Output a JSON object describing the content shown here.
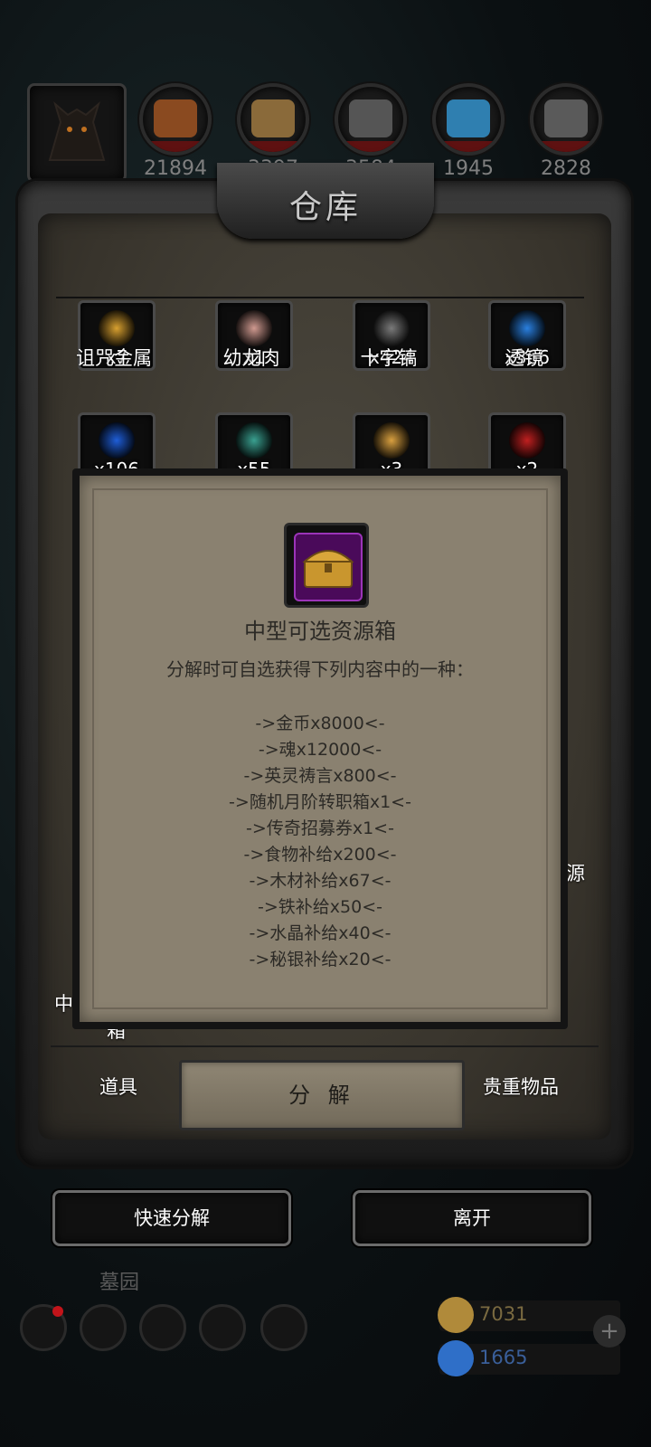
{
  "resources": [
    {
      "icon": "food-icon",
      "count": "21894",
      "color": "#8a4a20"
    },
    {
      "icon": "wood-icon",
      "count": "3397",
      "color": "#8a6a3a"
    },
    {
      "icon": "iron-icon",
      "count": "3584",
      "color": "#555555"
    },
    {
      "icon": "crystal-icon",
      "count": "1945",
      "color": "#2f7fb0"
    },
    {
      "icon": "mithril-icon",
      "count": "2828",
      "color": "#5a5a5a"
    }
  ],
  "window": {
    "title": "仓库"
  },
  "items_row1": [
    {
      "name": "诅咒金属",
      "qty": "x7",
      "color": "#d8a030"
    },
    {
      "name": "幼龙肉",
      "qty": "x1",
      "color": "#d09a90"
    },
    {
      "name": "十字镐",
      "qty": "x424",
      "color": "#7a7a7a"
    },
    {
      "name": "透镜",
      "qty": "x366",
      "color": "#2a80e0"
    }
  ],
  "items_row2": [
    {
      "qty": "x106",
      "color": "#1f5ed8"
    },
    {
      "qty": "x55",
      "color": "#3aa090"
    },
    {
      "qty": "x3",
      "color": "#d9a040"
    },
    {
      "qty": "x2",
      "color": "#c02020"
    }
  ],
  "edge": {
    "left_bottom": "中",
    "below_left": "箱",
    "right_mid": "源"
  },
  "popup": {
    "title": "中型可选资源箱",
    "description": "分解时可自选获得下列内容中的一种：",
    "options": [
      "->金币x8000<-",
      "->魂x12000<-",
      "->英灵祷言x800<-",
      "->随机月阶转职箱x1<-",
      "->传奇招募券x1<-",
      "->食物补给x200<-",
      "->木材补给x67<-",
      "->铁补给x50<-",
      "->水晶补给x40<-",
      "->秘银补给x20<-"
    ]
  },
  "tabs": {
    "left": "道具",
    "center": "分 解",
    "right": "贵重物品"
  },
  "buttons": {
    "quick": "快速分解",
    "leave": "离开"
  },
  "location": "墓园",
  "currency": [
    {
      "icon": "gold-scroll-icon",
      "value": "7031",
      "color": "#b08a3a"
    },
    {
      "icon": "blue-gem-icon",
      "value": "1665",
      "color": "#2f6fc8"
    }
  ]
}
